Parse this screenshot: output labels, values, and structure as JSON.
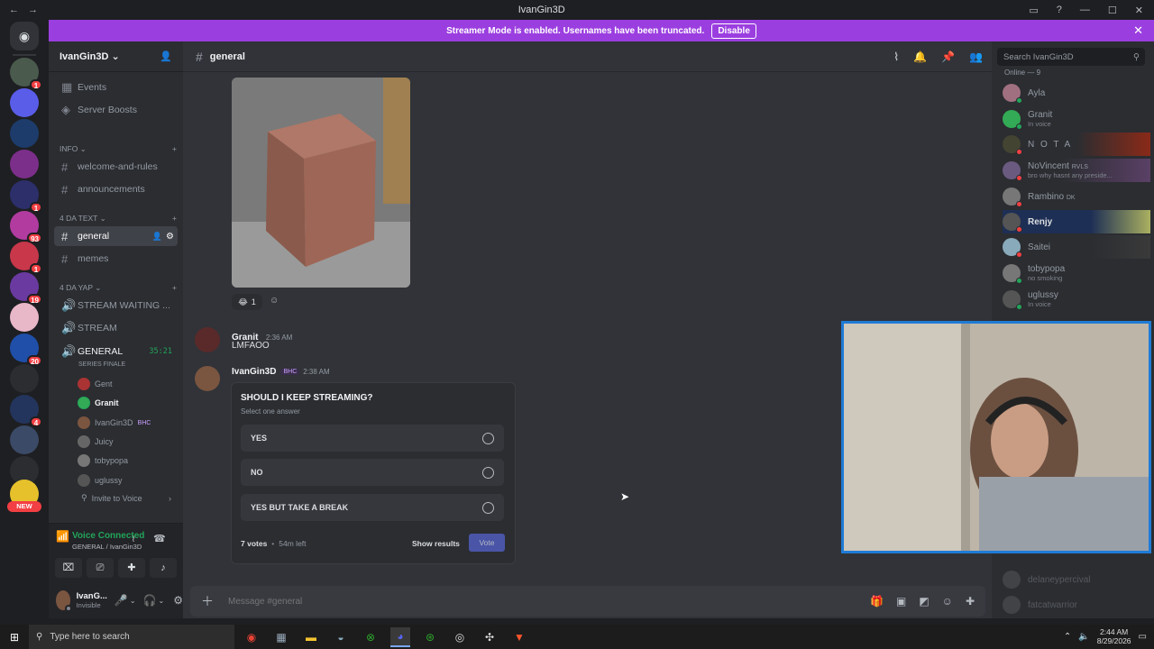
{
  "window": {
    "title": "IvanGin3D"
  },
  "banner": {
    "text": "Streamer Mode is enabled. Usernames have been truncated.",
    "button": "Disable",
    "close": "✕"
  },
  "guild_badges": [
    "1",
    "93",
    "1",
    "19",
    "20",
    "4"
  ],
  "new_label": "NEW",
  "server": {
    "name": "IvanGin3D"
  },
  "channels": {
    "events": "Events",
    "boosts": "Server Boosts",
    "cat_info": "INFO",
    "welcome": "welcome-and-rules",
    "announcements": "announcements",
    "cat_text": "4 DA TEXT",
    "general": "general",
    "memes": "memes",
    "cat_yap": "4 DA YAP",
    "stream_waiting": "STREAM WAITING ...",
    "stream": "STREAM",
    "general_voice": "GENERAL",
    "general_voice_time": "35:21",
    "series_finale": "SERIES FINALE",
    "invite": "Invite to Voice"
  },
  "voice_users": [
    {
      "name": "Gent",
      "tag": ""
    },
    {
      "name": "Granit",
      "tag": ""
    },
    {
      "name": "IvanGin3D",
      "tag": "BHC"
    },
    {
      "name": "Juicy",
      "tag": ""
    },
    {
      "name": "tobypopa",
      "tag": ""
    },
    {
      "name": "uglussy",
      "tag": ""
    }
  ],
  "voice": {
    "status": "Voice Connected",
    "location": "GENERAL / IvanGin3D"
  },
  "user": {
    "name": "IvanG...",
    "status": "Invisible"
  },
  "header": {
    "channel": "general"
  },
  "messages": {
    "reaction_count": "1",
    "m1_author": "Granit",
    "m1_time": "2:36 AM",
    "m1_text": "LMFAOO",
    "m2_author": "IvanGin3D",
    "m2_tag": "BHC",
    "m2_time": "2:38 AM"
  },
  "poll": {
    "question": "SHOULD I KEEP STREAMING?",
    "subtitle": "Select one answer",
    "options": [
      "YES",
      "NO",
      "YES BUT TAKE A BREAK"
    ],
    "votes": "7 votes",
    "sep": "•",
    "time_left": "54m left",
    "show_results": "Show results",
    "vote": "Vote"
  },
  "composer": {
    "placeholder": "Message #general"
  },
  "search": {
    "placeholder": "Search IvanGin3D"
  },
  "members_header": "Online — 9",
  "members": [
    {
      "name": "Ayla",
      "sub": ""
    },
    {
      "name": "Granit",
      "sub": "In voice"
    },
    {
      "name": "N O T A",
      "sub": ""
    },
    {
      "name": "NoVincent",
      "tag": "RVLS",
      "sub": "bro why hasnt any preside..."
    },
    {
      "name": "Rambino",
      "tag": "DK",
      "sub": ""
    },
    {
      "name": "Renjy",
      "sub": ""
    },
    {
      "name": "Saitei",
      "sub": ""
    },
    {
      "name": "tobypopa",
      "sub": "no smoking"
    },
    {
      "name": "uglussy",
      "sub": "In voice"
    }
  ],
  "offline_members": [
    "delaneypercival",
    "fatcatwarrior"
  ],
  "taskbar": {
    "search": "Type here to search",
    "time": "2:44 AM",
    "date": "8/29/2026"
  },
  "colors": {
    "accent": "#5865f2",
    "banner": "#9b3ee0",
    "voice_green": "#23a55a"
  }
}
